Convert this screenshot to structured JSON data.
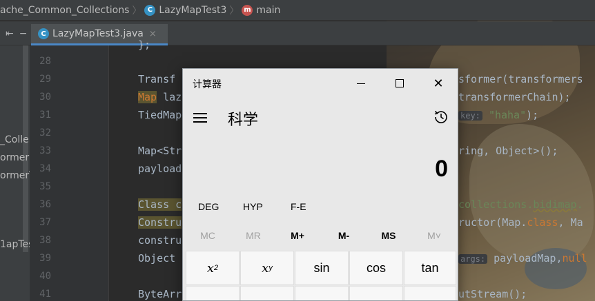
{
  "breadcrumb": {
    "project": "ache_Common_Collections",
    "class_name": "LazyMapTest3",
    "method_name": "main",
    "class_icon_letter": "C",
    "method_icon_letter": "m"
  },
  "tabs": [
    {
      "label": "LazyMapTest3.java",
      "close": "×",
      "active": true
    }
  ],
  "project_panel": {
    "toolbar_glyphs": [
      "⇤",
      "−"
    ],
    "items": [
      "_Colle",
      "ormer",
      "ormerT",
      "1apTes"
    ]
  },
  "gutter": {
    "line_numbers": [
      "28",
      "29",
      "30",
      "31",
      "32",
      "33",
      "34",
      "35",
      "36",
      "37",
      "38",
      "39",
      "40",
      "41"
    ]
  },
  "code": {
    "line_27_tail": "};",
    "line_29_left": "Transf",
    "line_29_right": "sformer(transformers",
    "line_30_left_kw": "Map",
    "line_30_left": " laz",
    "line_30_right": "transformerChain);",
    "line_31_left": "TiedMap",
    "line_31_hint": "key:",
    "line_31_str": "\"haha\"",
    "line_31_end": ");",
    "line_33_left": "Map<Str",
    "line_33_right": "ring, Object>();",
    "line_34_left": "payload",
    "line_36_left": "Class c",
    "line_36_right": "collections.",
    "line_36_warn": "bidimap",
    "line_36_tail": ".",
    "line_37_left": "Constru",
    "line_37_right": "ructor(Map.",
    "line_37_kw": "class",
    "line_37_tail": ", Ma",
    "line_38_left": "constru",
    "line_39_left": "Object",
    "line_39_hint": "args:",
    "line_39_right": " payloadMap,",
    "line_39_kw": "null",
    "line_41_left": "ByteArr",
    "line_41_right": "utStream();"
  },
  "calculator": {
    "window_title": "计算器",
    "mode_title": "科学",
    "display_value": "0",
    "window_buttons": {
      "close": "✕"
    },
    "angle_buttons": [
      "DEG",
      "HYP",
      "F-E"
    ],
    "memory_buttons": [
      {
        "label": "MC",
        "enabled": false
      },
      {
        "label": "MR",
        "enabled": false
      },
      {
        "label": "M+",
        "enabled": true
      },
      {
        "label": "M-",
        "enabled": true
      },
      {
        "label": "MS",
        "enabled": true
      },
      {
        "label": "M˅",
        "enabled": false
      }
    ],
    "function_keys_row1": [
      {
        "base": "x",
        "sup": "2"
      },
      {
        "base": "x",
        "sup": "y"
      },
      {
        "label": "sin"
      },
      {
        "label": "cos"
      },
      {
        "label": "tan"
      }
    ]
  }
}
